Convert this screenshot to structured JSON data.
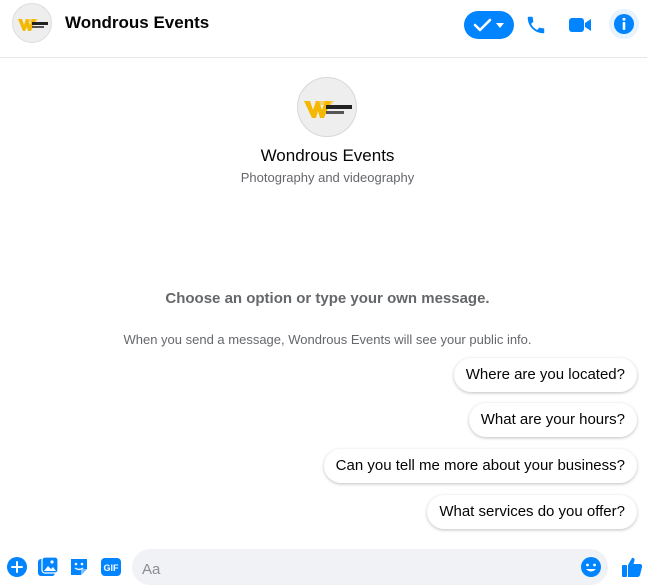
{
  "header": {
    "title": "Wondrous Events",
    "avatar_logo_text": "WONDROUS EVENTS",
    "icons": [
      "check-dropdown-icon",
      "phone-icon",
      "video-camera-icon",
      "info-icon"
    ]
  },
  "profile": {
    "name": "Wondrous Events",
    "subtitle": "Photography and videography",
    "logo_text": "WONDROUS EVENTS"
  },
  "prompt": "Choose an option or type your own message.",
  "info_note": "When you send a message, Wondrous Events will see your public info.",
  "quick_replies": [
    "Where are you located?",
    "What are your hours?",
    "Can you tell me more about your business?",
    "What services do you offer?"
  ],
  "composer": {
    "placeholder": "Aa",
    "gif_label": "GIF",
    "icons": [
      "plus-icon",
      "photo-icon",
      "sticker-icon",
      "gif-icon",
      "emoji-icon",
      "thumbs-up-icon"
    ]
  },
  "colors": {
    "accent": "#0084ff",
    "info_bg": "#e7f3ff",
    "logo_yellow": "#f5b800",
    "muted_text": "#65676b",
    "input_bg": "#f0f2f5"
  }
}
